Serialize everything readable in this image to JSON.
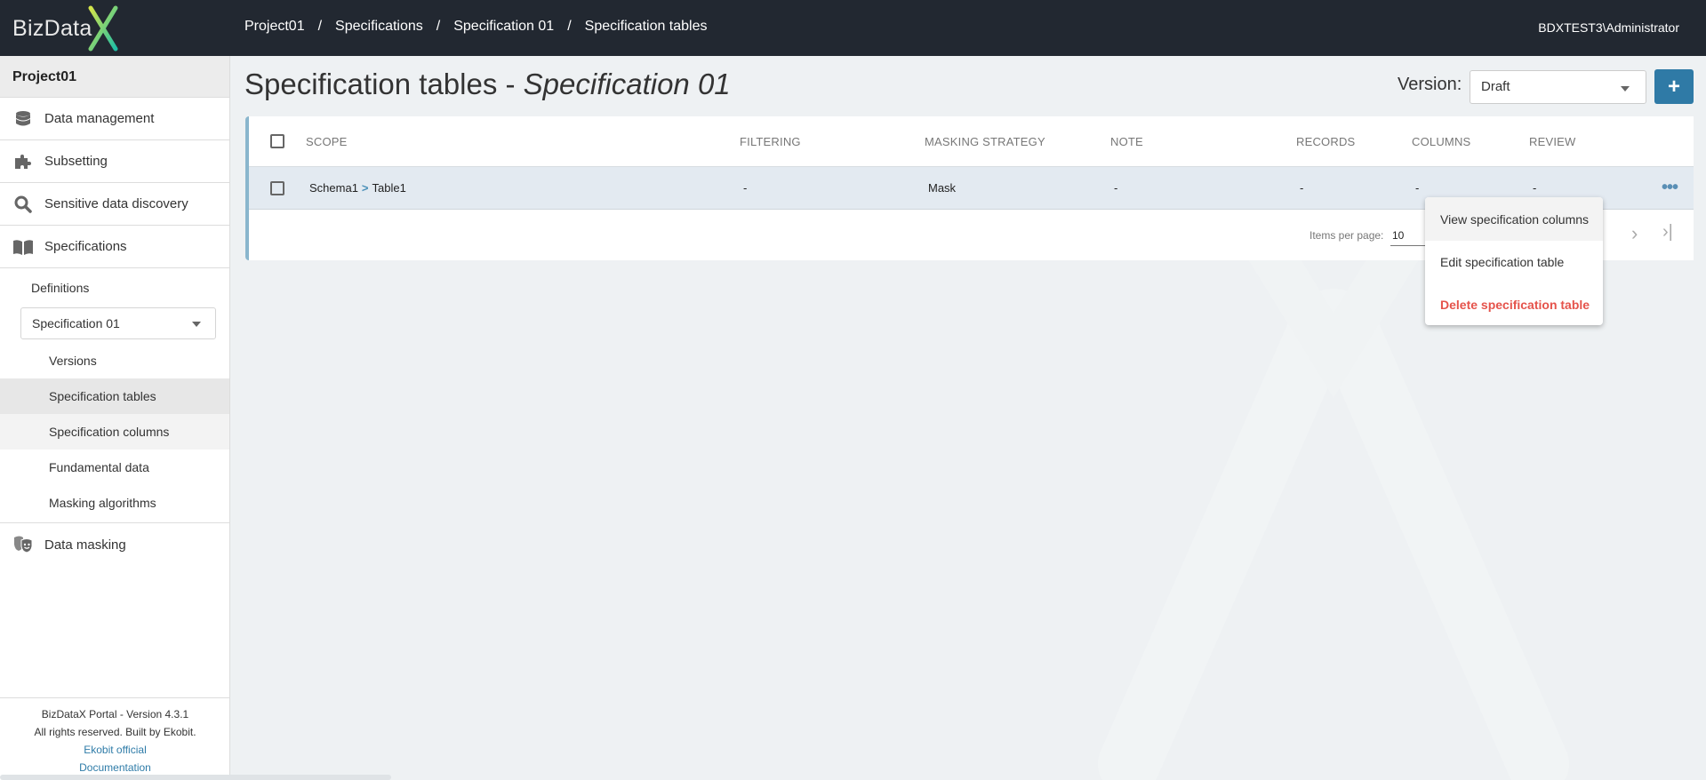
{
  "app": {
    "logo_text": "BizData",
    "logo_mark": "X",
    "user": "BDXTEST3\\Administrator",
    "accent_color": "#2f7aa6",
    "danger_color": "#e5534b"
  },
  "breadcrumb": [
    {
      "label": "Project01"
    },
    {
      "label": "Specifications"
    },
    {
      "label": "Specification 01"
    },
    {
      "label": "Specification tables"
    }
  ],
  "breadcrumb_separator": "/",
  "sidebar": {
    "project": "Project01",
    "items": [
      {
        "label": "Data management",
        "icon": "database-icon"
      },
      {
        "label": "Subsetting",
        "icon": "puzzle-icon"
      },
      {
        "label": "Sensitive data discovery",
        "icon": "search-icon"
      },
      {
        "label": "Specifications",
        "icon": "book-icon"
      }
    ],
    "definitions_label": "Definitions",
    "spec_select_value": "Specification 01",
    "sub_links": [
      {
        "label": "Versions"
      },
      {
        "label": "Specification tables",
        "active": true
      },
      {
        "label": "Specification columns"
      },
      {
        "label": "Fundamental data"
      },
      {
        "label": "Masking algorithms"
      }
    ],
    "bottom_item": {
      "label": "Data masking",
      "icon": "masks-icon"
    },
    "footer": {
      "version": "BizDataX Portal - Version 4.3.1",
      "rights": "All rights reserved. Built by Ekobit.",
      "link1": "Ekobit official",
      "link2": "Documentation"
    }
  },
  "main": {
    "title": "Specification tables - ",
    "title_italic": "Specification 01",
    "version_label": "Version:",
    "version_value": "Draft",
    "add_button": "+",
    "table": {
      "columns": [
        "SCOPE",
        "FILTERING",
        "MASKING STRATEGY",
        "NOTE",
        "RECORDS",
        "COLUMNS",
        "REVIEW"
      ],
      "rows": [
        {
          "schema": "Schema1",
          "scope_sep": ">",
          "table": "Table1",
          "filtering": "-",
          "masking_strategy": "Mask",
          "note": "-",
          "records": "-",
          "columns": "-",
          "review": "-"
        }
      ],
      "row_actions_icon": "•••"
    },
    "pagination": {
      "items_per_page_label": "Items per page:",
      "items_per_page_value": "10",
      "next": "›",
      "last": "›|"
    },
    "context_menu": [
      {
        "label": "View specification columns"
      },
      {
        "label": "Edit specification table"
      },
      {
        "label": "Delete specification table",
        "danger": true
      }
    ]
  }
}
